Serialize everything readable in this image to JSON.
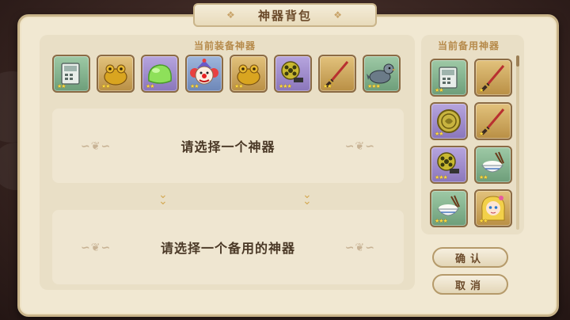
{
  "window": {
    "title": "神器背包"
  },
  "equipped": {
    "label": "当前装备神器",
    "slots": [
      {
        "icon": "cash-register-icon",
        "quality": "green",
        "stars": "★★"
      },
      {
        "icon": "golden-toad-icon",
        "quality": "gold",
        "stars": "★★"
      },
      {
        "icon": "green-jelly-icon",
        "quality": "purple",
        "stars": "★★"
      },
      {
        "icon": "clown-icon",
        "quality": "blue",
        "stars": "★★"
      },
      {
        "icon": "golden-toad-icon",
        "quality": "gold",
        "stars": "★★"
      },
      {
        "icon": "bazooka-icon",
        "quality": "purple",
        "stars": "★★★"
      },
      {
        "icon": "katana-icon",
        "quality": "gold",
        "stars": "★★"
      },
      {
        "icon": "pigeon-icon",
        "quality": "green",
        "stars": "★★★"
      }
    ]
  },
  "prompts": {
    "select_artifact": "请选择一个神器",
    "select_spare": "请选择一个备用的神器"
  },
  "spare": {
    "label": "当前备用神器",
    "slots": [
      {
        "icon": "cash-register-icon",
        "quality": "green",
        "stars": "★★"
      },
      {
        "icon": "katana-icon",
        "quality": "gold",
        "stars": "★"
      },
      {
        "icon": "gold-coin-icon",
        "quality": "purple",
        "stars": "★★"
      },
      {
        "icon": "katana-icon",
        "quality": "gold",
        "stars": "★"
      },
      {
        "icon": "bazooka-icon",
        "quality": "purple",
        "stars": "★★★"
      },
      {
        "icon": "rice-bowl-icon",
        "quality": "green",
        "stars": "★★"
      },
      {
        "icon": "rice-bowl-icon",
        "quality": "green",
        "stars": "★★★"
      },
      {
        "icon": "blonde-girl-icon",
        "quality": "gold",
        "stars": "★★"
      }
    ]
  },
  "buttons": {
    "confirm": "确认",
    "cancel": "取消"
  }
}
